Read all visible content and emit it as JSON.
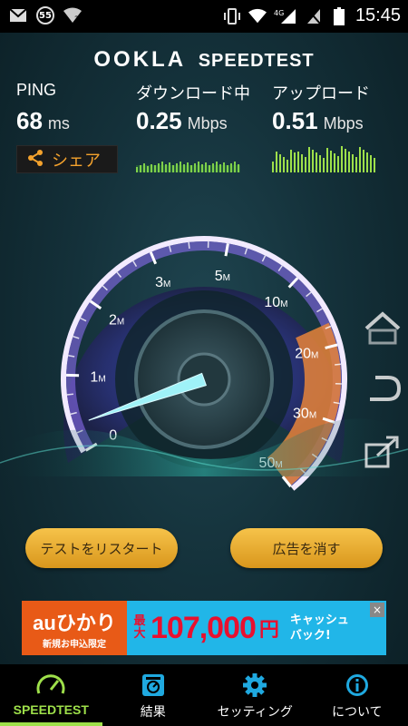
{
  "status_bar": {
    "notification_badge": "55",
    "network_type": "4G",
    "time": "15:45"
  },
  "brand": {
    "ookla": "OOKLA",
    "speedtest": "SPEEDTEST"
  },
  "metrics": {
    "ping": {
      "label": "PING",
      "value": "68",
      "unit": "ms"
    },
    "download": {
      "label": "ダウンロード中",
      "value": "0.25",
      "unit": "Mbps"
    },
    "upload": {
      "label": "アップロード",
      "value": "0.51",
      "unit": "Mbps"
    }
  },
  "share_label": "シェア",
  "gauge": {
    "ticks": [
      "0",
      "1",
      "2",
      "3",
      "5",
      "10",
      "20",
      "30",
      "50"
    ],
    "tick_suffix": "M",
    "needle_value_mbps": 0.25
  },
  "buttons": {
    "restart": "テストをリスタート",
    "remove_ads": "広告を消す"
  },
  "ad": {
    "brand": "auひかり",
    "sub": "新規お申込限定",
    "max": "最大",
    "amount": "107,000",
    "yen": "円",
    "cash_line1": "キャッシュ",
    "cash_line2": "バック!",
    "close": "×"
  },
  "nav": {
    "speedtest": "SPEEDTEST",
    "results": "結果",
    "settings": "セッティング",
    "about": "について"
  },
  "colors": {
    "accent_green": "#9ee04a",
    "share_orange": "#f4a22d",
    "gauge_purple": "#8a6cf0",
    "gauge_orange": "#e7843a",
    "needle_cyan": "#7fe8f2",
    "button_gold": "#f1b63c"
  },
  "icons": [
    "gmail-icon",
    "notification-badge-icon",
    "wifi-question-icon",
    "vibrate-icon",
    "wifi-icon",
    "signal-icon",
    "no-sim-icon",
    "battery-icon",
    "share-icon",
    "speedometer-icon",
    "results-icon",
    "gear-icon",
    "info-icon",
    "home-icon",
    "back-icon",
    "share-arrow-icon"
  ]
}
